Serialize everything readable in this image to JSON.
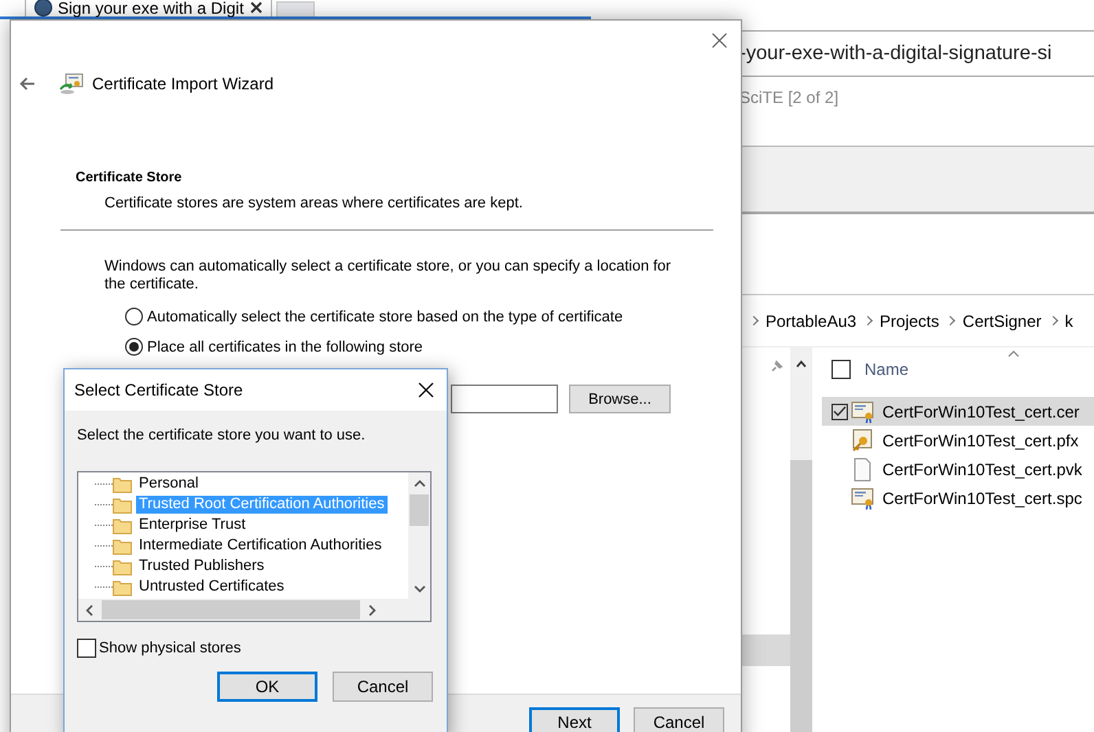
{
  "browser": {
    "tab_title": "Sign your exe with a Digit",
    "url_text": "-your-exe-with-a-digital-signature-si",
    "editor_caption": "SciTE [2 of 2]"
  },
  "explorer": {
    "breadcrumb": [
      "PortableAu3",
      "Projects",
      "CertSigner",
      "k"
    ],
    "column": "Name",
    "select_all_checked": false,
    "files": [
      {
        "name": "CertForWin10Test_cert.cer",
        "kind": "certificate",
        "selected": true,
        "checked": true
      },
      {
        "name": "CertForWin10Test_cert.pfx",
        "kind": "keyfile",
        "selected": false,
        "checked": false
      },
      {
        "name": "CertForWin10Test_cert.pvk",
        "kind": "document",
        "selected": false,
        "checked": false
      },
      {
        "name": "CertForWin10Test_cert.spc",
        "kind": "certificate",
        "selected": false,
        "checked": false
      }
    ]
  },
  "wizard": {
    "title": "Certificate Import Wizard",
    "heading": "Certificate Store",
    "subheading": "Certificate stores are system areas where certificates are kept.",
    "intro": "Windows can automatically select a certificate store, or you can specify a location for the certificate.",
    "options": [
      {
        "label": "Automatically select the certificate store based on the type of certificate",
        "selected": false
      },
      {
        "label": "Place all certificates in the following store",
        "selected": true
      }
    ],
    "browse": "Browse...",
    "buttons": [
      {
        "label": "Next",
        "default": true
      },
      {
        "label": "Cancel",
        "default": false
      }
    ]
  },
  "dialog": {
    "title": "Select Certificate Store",
    "prompt": "Select the certificate store you want to use.",
    "stores": [
      {
        "label": "Personal",
        "selected": false
      },
      {
        "label": "Trusted Root Certification Authorities",
        "selected": true
      },
      {
        "label": "Enterprise Trust",
        "selected": false
      },
      {
        "label": "Intermediate Certification Authorities",
        "selected": false
      },
      {
        "label": "Trusted Publishers",
        "selected": false
      },
      {
        "label": "Untrusted Certificates",
        "selected": false
      }
    ],
    "show_physical": {
      "label": "Show physical stores",
      "checked": false
    },
    "buttons": [
      {
        "label": "OK",
        "default": true
      },
      {
        "label": "Cancel",
        "default": false
      }
    ]
  }
}
